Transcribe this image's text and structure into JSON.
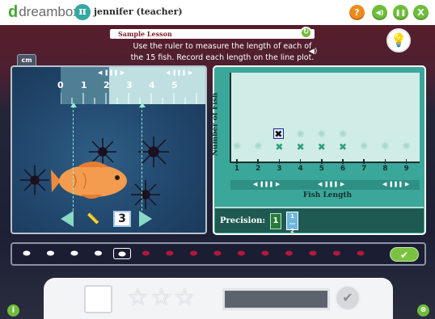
{
  "header": {
    "logo_mark": "d",
    "logo_word": "dreambox",
    "avatar_glyph": "π",
    "user": "jennifer (teacher)",
    "help_glyph": "?",
    "sound_glyph": "◀)",
    "pause_glyph": "❚❚",
    "close_glyph": "X"
  },
  "lesson": {
    "title": "Sample Lesson",
    "instruction": "Use the ruler to measure the length of each of the 15 fish. Record each length on the line plot.",
    "replay_glyph": "↻",
    "speaker_glyph": "◀)",
    "hint_glyph": "💡"
  },
  "ruler": {
    "unit_tab": "cm",
    "numbers": [
      "0",
      "1",
      "2",
      "3",
      "4",
      "5"
    ],
    "scroll_glyph": "◀ ❚❚❚ ▶"
  },
  "measure": {
    "value": "3",
    "prev_glyph": "◀",
    "next_glyph": "▶",
    "ruler_glyph": "📏"
  },
  "plot": {
    "ylabel": "Number of Fish",
    "xlabel": "Fish Length",
    "ticks": [
      "1",
      "2",
      "3",
      "4",
      "5",
      "6",
      "7",
      "8",
      "9"
    ],
    "current_mark": 3,
    "recorded_marks": [
      3,
      4,
      5,
      6
    ],
    "mark_glyph": "✖",
    "scroll_glyph": "◀ ❚❚❚ ▶"
  },
  "precision": {
    "label": "Precision:",
    "option1": "1",
    "option2": "1\n―\n2",
    "selected": "1/2"
  },
  "tray": {
    "fish_glyph": "⬬",
    "done_count": 4,
    "active_index": 4,
    "total": 15,
    "check_glyph": "✔"
  },
  "bottom": {
    "star_glyph": "☆",
    "stars": 3,
    "check_glyph": "✔"
  },
  "footer": {
    "info_glyph": "i",
    "close_glyph": "⊗"
  },
  "colors": {
    "accent_green": "#6fbd3b",
    "help_orange": "#f08a1c",
    "plot_teal": "#3aa79a",
    "fish_orange": "#f19a4e",
    "todo_fish": "#b3173c"
  }
}
